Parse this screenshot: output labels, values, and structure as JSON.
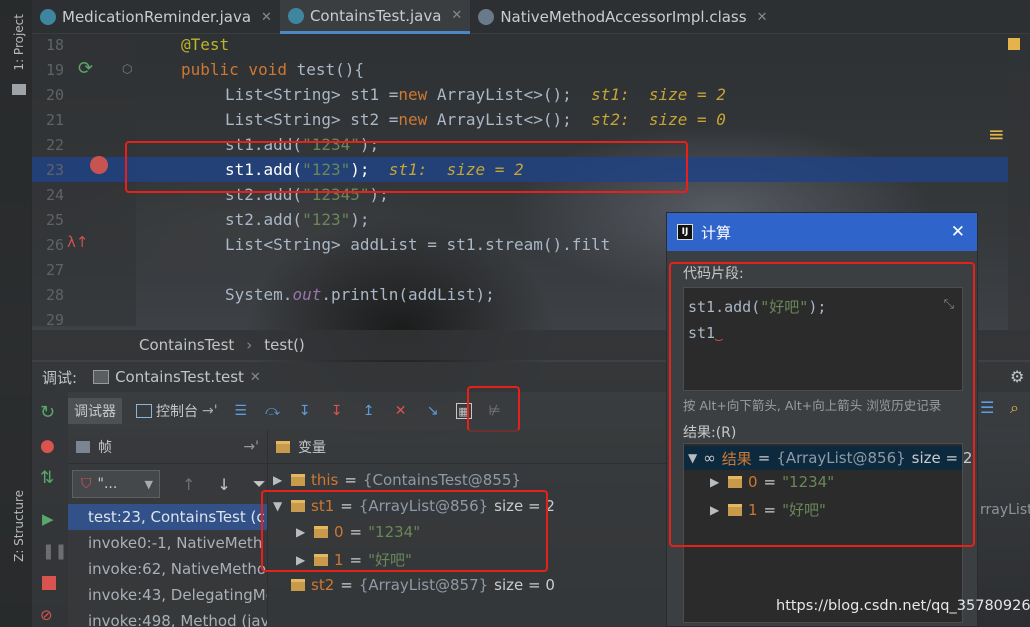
{
  "tabs": [
    {
      "label": "MedicationReminder.java"
    },
    {
      "label": "ContainsTest.java"
    },
    {
      "label": "NativeMethodAccessorImpl.class"
    }
  ],
  "left_strip": {
    "project_label": "1: Project",
    "structure_label": "Z: Structure"
  },
  "editor": {
    "lines": [
      {
        "num": "18",
        "annotation": "@Test"
      },
      {
        "num": "19",
        "kw": "public void",
        "rest": " test(){"
      },
      {
        "num": "20",
        "code_pre": "List<String> st1 =",
        "kw": "new",
        "code_post": " ArrayList<>();",
        "hint": "st1:  size = 2"
      },
      {
        "num": "21",
        "code_pre": "List<String> st2 =",
        "kw": "new",
        "code_post": " ArrayList<>();",
        "hint": "st2:  size = 0"
      },
      {
        "num": "22",
        "call": "st1.add(",
        "str": "\"1234\"",
        "end": ");"
      },
      {
        "num": "23",
        "call": "st1.add(",
        "str": "\"123\"",
        "end": ");",
        "hint": "st1:  size = 2"
      },
      {
        "num": "24",
        "call": "st2.add(",
        "str": "\"12345\"",
        "end": ");"
      },
      {
        "num": "25",
        "call": "st2.add(",
        "str": "\"123\"",
        "end": ");"
      },
      {
        "num": "26",
        "code": "List<String> addList = st1.stream().filt"
      },
      {
        "num": "27"
      },
      {
        "num": "28",
        "sys": "System.",
        "sys_out": "out",
        "sys_rest": ".println(addList);"
      },
      {
        "num": "29"
      }
    ]
  },
  "breadcrumb": {
    "class_name": "ContainsTest",
    "method_name": "test()"
  },
  "debug": {
    "title_label": "调试:",
    "session_tab": "ContainsTest.test",
    "toolbar": {
      "debugger_tab": "调试器",
      "console_tab": "控制台"
    },
    "frames_header": "帧",
    "thread_selector": "\"...",
    "frames": [
      "test:23, ContainsTest (c",
      "invoke0:-1, NativeMeth",
      "invoke:62, NativeMetho",
      "invoke:43, DelegatingMe",
      "invoke:498, Method (jav"
    ],
    "variables_header": "变量",
    "variables": [
      {
        "name": "this",
        "eq": " = ",
        "ref": "{ContainsTest@855}"
      },
      {
        "name": "st1",
        "eq": " = ",
        "ref": "{ArrayList@856}",
        "size": "size = 2"
      },
      {
        "name": "0",
        "eq": " = ",
        "value": "\"1234\""
      },
      {
        "name": "1",
        "eq": " = ",
        "value": "\"好吧\""
      },
      {
        "name": "st2",
        "eq": " = ",
        "ref": "{ArrayList@857}",
        "size": "size = 0"
      }
    ]
  },
  "dialog": {
    "title": "计算",
    "snippet_label": "代码片段:",
    "snippet_line1_call": "st1.add(",
    "snippet_line1_str": "\"好吧\"",
    "snippet_line1_end": ");",
    "snippet_line2": "st1",
    "hint": "按 Alt+向下箭头, Alt+向上箭头 浏览历史记录",
    "result_label": "结果:(R)",
    "result": {
      "name": "结果",
      "eq": " = ",
      "ref": "{ArrayList@856}",
      "size": "size = 2"
    },
    "items": [
      {
        "name": "0",
        "eq": " = ",
        "value": "\"1234\""
      },
      {
        "name": "1",
        "eq": " = ",
        "value": "\"好吧\""
      }
    ]
  },
  "overflow_text": "rrayList",
  "watermark": "https://blog.csdn.net/qq_35780926",
  "colors": {
    "accent": "#2f65ca",
    "highlight_box": "#e8201a",
    "selection": "#214283"
  }
}
